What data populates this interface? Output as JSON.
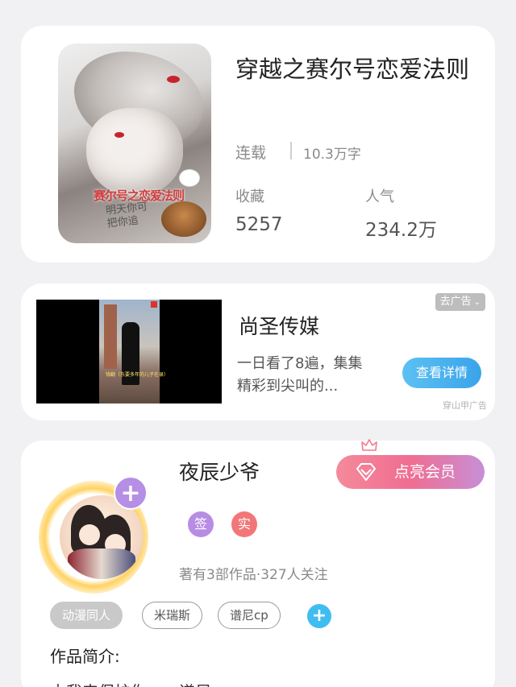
{
  "book": {
    "title": "穿越之赛尔号恋爱法则",
    "status": "连载",
    "word_count": "10.3万字",
    "favorites_label": "收藏",
    "favorites_value": "5257",
    "popularity_label": "人气",
    "popularity_value": "234.2万",
    "cover_art_text": "赛尔号之恋爱法则",
    "cover_scribble": "明天你可\n把你追"
  },
  "ad": {
    "title": "尚圣传媒",
    "description": "一日看了8遍，集集精彩到尖叫的...",
    "close_label": "去广告",
    "detail_button": "查看详情",
    "source": "穿山甲广告",
    "video_subtitle": "钱翻（东要多年的儿子在录）"
  },
  "author": {
    "name": "夜辰少爷",
    "vip_button": "点亮会员",
    "badge_sign": "签",
    "badge_real": "实",
    "meta": "著有3部作品·327人关注",
    "tags": [
      "动漫同人",
      "米瑞斯",
      "谱尼cp"
    ],
    "intro_label": "作品简介:",
    "intro_text": "由我来保护你……谱尼"
  },
  "colors": {
    "background": "#f1f1f3",
    "vip_gradient_start": "#f58a9a",
    "vip_gradient_end": "#c78fd6",
    "detail_button": "#3aa4ea",
    "badge_sign": "#b78de4",
    "badge_real": "#f27678",
    "tag_add": "#3fbdf0"
  },
  "icons": {
    "avatar_plus": "plus-icon",
    "tag_add": "plus-icon",
    "crown": "crown-icon",
    "vip": "diamond-icon",
    "close_chevron": "chevron-down-icon"
  }
}
